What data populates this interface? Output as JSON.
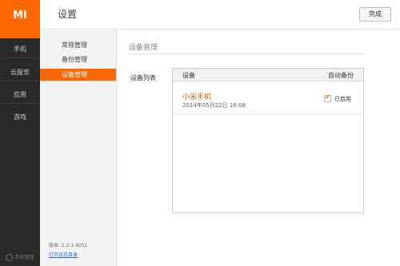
{
  "rail": {
    "logo": "MI",
    "items": [
      "手机",
      "云服务",
      "应用",
      "游戏"
    ],
    "bottom_label": "手机管理"
  },
  "header": {
    "title": "设置",
    "done_label": "完成"
  },
  "subnav": {
    "items": [
      {
        "label": "常规管理",
        "active": false
      },
      {
        "label": "备份管理",
        "active": false
      },
      {
        "label": "设备管理",
        "active": true
      }
    ],
    "version": "版本: 1.2.1.4251",
    "log_link": "打开日志目录"
  },
  "main": {
    "section_title": "设备管理",
    "list_label": "设备列表",
    "table": {
      "col_device": "设备",
      "col_backup": "自动备份",
      "rows": [
        {
          "name": "小米手机",
          "date": "2014年05月22日 16:08",
          "backup_checked": true,
          "backup_text": "已启用"
        }
      ]
    }
  },
  "colors": {
    "accent": "#ff6700",
    "rail_bg": "#2a2a2a",
    "subnav_bg": "#f3f3f3"
  }
}
